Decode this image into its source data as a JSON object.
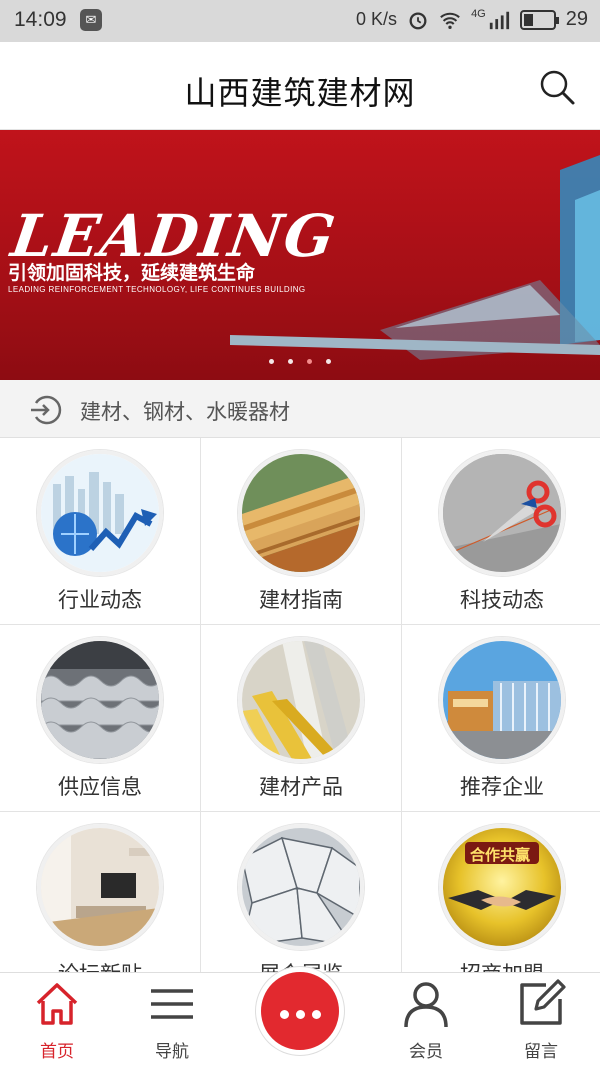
{
  "status_bar": {
    "time": "14:09",
    "net_speed": "0 K/s",
    "network": "4G",
    "battery": "29"
  },
  "header": {
    "title": "山西建筑建材网"
  },
  "banner": {
    "headline": "LEADING",
    "slogan": "引领加固科技，延续建筑生命",
    "slogan_en": "LEADING REINFORCEMENT TECHNOLOGY, LIFE CONTINUES BUILDING",
    "slide_count": 4,
    "active_slide": 2
  },
  "notice": {
    "text": "建材、钢材、水暖器材"
  },
  "grid": [
    {
      "label": "行业动态",
      "icon": "industry-news-icon"
    },
    {
      "label": "建材指南",
      "icon": "materials-guide-icon"
    },
    {
      "label": "科技动态",
      "icon": "tech-news-icon"
    },
    {
      "label": "供应信息",
      "icon": "supply-info-icon"
    },
    {
      "label": "建材产品",
      "icon": "materials-products-icon"
    },
    {
      "label": "推荐企业",
      "icon": "recommended-company-icon"
    },
    {
      "label": "论坛新贴",
      "icon": "forum-posts-icon"
    },
    {
      "label": "展会展览",
      "icon": "exhibition-icon"
    },
    {
      "label": "招商加盟",
      "icon": "franchise-icon"
    }
  ],
  "grid_extra": {
    "franchise_badge": "合作共赢"
  },
  "tabbar": {
    "home": "首页",
    "nav": "导航",
    "member": "会员",
    "message": "留言"
  },
  "colors": {
    "brand_red": "#d7232b",
    "banner_red": "#b5111a",
    "fab_red": "#e2292f"
  }
}
